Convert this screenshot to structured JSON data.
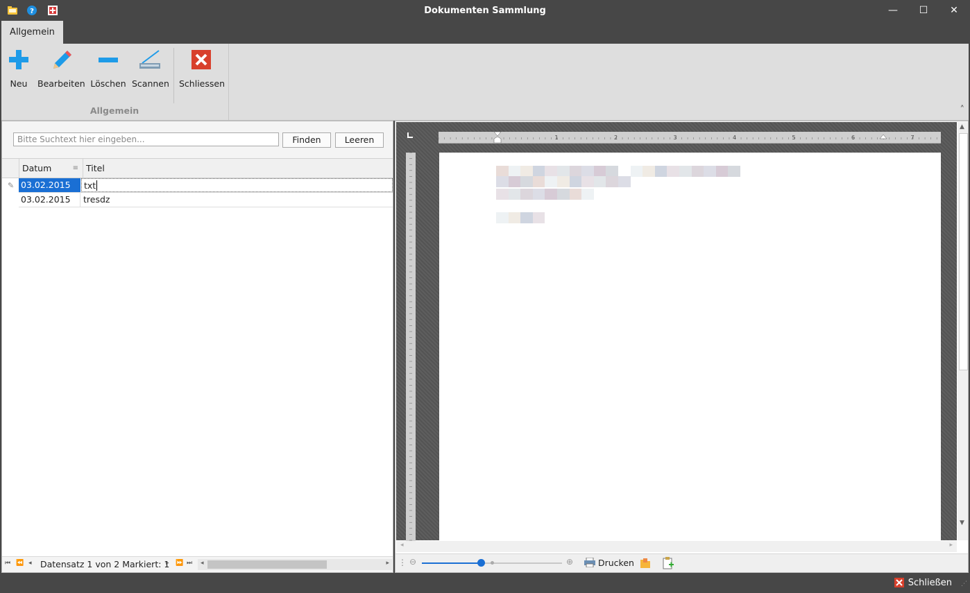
{
  "window": {
    "title": "Dokumenten Sammlung",
    "minimize": "—",
    "maximize": "☐",
    "close": "✕"
  },
  "tabs": [
    {
      "label": "Allgemein"
    }
  ],
  "ribbon": {
    "group_label": "Allgemein",
    "buttons": [
      {
        "label": "Neu",
        "icon": "plus-icon"
      },
      {
        "label": "Bearbeiten",
        "icon": "pencil-icon"
      },
      {
        "label": "Löschen",
        "icon": "minus-icon"
      },
      {
        "label": "Scannen",
        "icon": "scanner-icon"
      },
      {
        "label": "Schliessen",
        "icon": "close-icon"
      }
    ],
    "collapse": "˄"
  },
  "search": {
    "placeholder": "Bitte Suchtext hier eingeben...",
    "value": "",
    "find_label": "Finden",
    "clear_label": "Leeren"
  },
  "grid": {
    "columns": [
      "Datum",
      "Titel"
    ],
    "rows": [
      {
        "datum": "03.02.2015",
        "titel": "txt",
        "selected": true
      },
      {
        "datum": "03.02.2015",
        "titel": "tresdz",
        "selected": false
      }
    ],
    "footer": {
      "record_text": "Datensatz 1 von 2 Markiert: 1"
    }
  },
  "preview": {
    "ruler_numbers": [
      "1",
      "2",
      "3",
      "4",
      "5",
      "6",
      "7"
    ],
    "print_label": "Drucken",
    "zoom_level_fraction": 0.42
  },
  "statusbar": {
    "close_label": "Schließen"
  },
  "colors": {
    "selection": "#1a6fd4",
    "chrome": "#474747",
    "ribbon": "#dedede",
    "accent_icon": "#1e9be8",
    "close_red": "#d8402c"
  }
}
